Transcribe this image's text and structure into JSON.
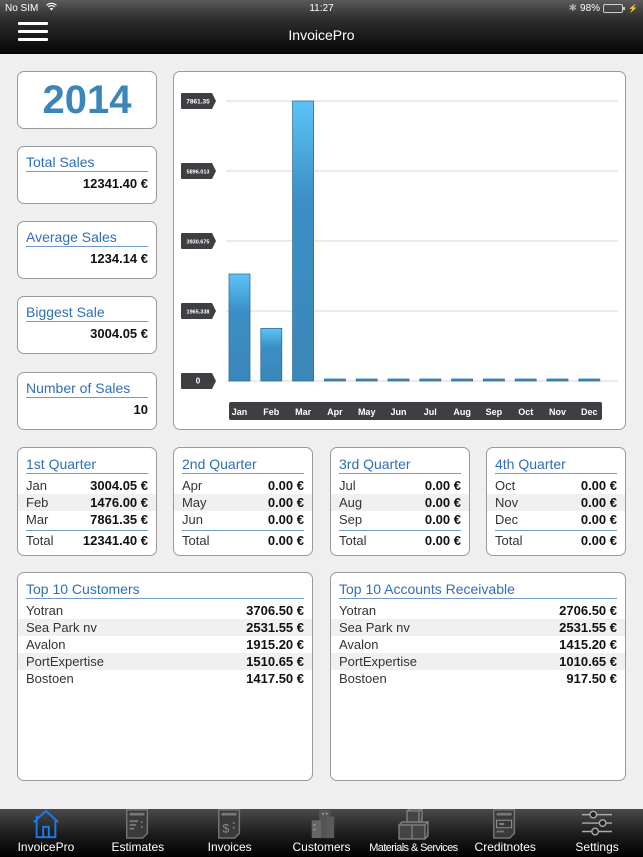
{
  "status_bar": {
    "carrier": "No SIM",
    "time": "11:27",
    "battery": "98%",
    "battery_level": 0.98
  },
  "header": {
    "title": "InvoicePro",
    "menu_icon": "hamburger-menu-icon"
  },
  "year": "2014",
  "stats": [
    {
      "label": "Total Sales",
      "value": "12341.40 €"
    },
    {
      "label": "Average Sales",
      "value": "1234.14 €"
    },
    {
      "label": "Biggest Sale",
      "value": "3004.05 €"
    },
    {
      "label": "Number of Sales",
      "value": "10"
    }
  ],
  "chart_data": {
    "type": "bar",
    "title": "",
    "xlabel": "",
    "ylabel": "",
    "categories": [
      "Jan",
      "Feb",
      "Mar",
      "Apr",
      "May",
      "Jun",
      "Jul",
      "Aug",
      "Sep",
      "Oct",
      "Nov",
      "Dec"
    ],
    "values": [
      3004.05,
      1476.0,
      7861.35,
      0,
      0,
      0,
      0,
      0,
      0,
      0,
      0,
      0
    ],
    "y_ticks": [
      "0",
      "1965.338",
      "3930.675",
      "5896.013",
      "7861.35"
    ],
    "ylim": [
      0,
      7861.35
    ],
    "grid": true,
    "bar_color": "#3b8fc6"
  },
  "quarters": [
    {
      "title": "1st Quarter",
      "rows": [
        {
          "label": "Jan",
          "value": "3004.05 €"
        },
        {
          "label": "Feb",
          "value": "1476.00 €"
        },
        {
          "label": "Mar",
          "value": "7861.35 €"
        }
      ],
      "total_label": "Total",
      "total": "12341.40 €"
    },
    {
      "title": "2nd Quarter",
      "rows": [
        {
          "label": "Apr",
          "value": "0.00 €"
        },
        {
          "label": "May",
          "value": "0.00 €"
        },
        {
          "label": "Jun",
          "value": "0.00 €"
        }
      ],
      "total_label": "Total",
      "total": "0.00 €"
    },
    {
      "title": "3rd Quarter",
      "rows": [
        {
          "label": "Jul",
          "value": "0.00 €"
        },
        {
          "label": "Aug",
          "value": "0.00 €"
        },
        {
          "label": "Sep",
          "value": "0.00 €"
        }
      ],
      "total_label": "Total",
      "total": "0.00 €"
    },
    {
      "title": "4th Quarter",
      "rows": [
        {
          "label": "Oct",
          "value": "0.00 €"
        },
        {
          "label": "Nov",
          "value": "0.00 €"
        },
        {
          "label": "Dec",
          "value": "0.00 €"
        }
      ],
      "total_label": "Total",
      "total": "0.00 €"
    }
  ],
  "top_customers": {
    "title": "Top 10 Customers",
    "rows": [
      {
        "label": "Yotran",
        "value": "3706.50 €"
      },
      {
        "label": "Sea Park nv",
        "value": "2531.55 €"
      },
      {
        "label": "Avalon",
        "value": "1915.20 €"
      },
      {
        "label": "PortExpertise",
        "value": "1510.65 €"
      },
      {
        "label": "Bostoen",
        "value": "1417.50 €"
      }
    ]
  },
  "top_receivables": {
    "title": "Top 10 Accounts Receivable",
    "rows": [
      {
        "label": "Yotran",
        "value": "2706.50 €"
      },
      {
        "label": "Sea Park nv",
        "value": "2531.55 €"
      },
      {
        "label": "Avalon",
        "value": "1415.20 €"
      },
      {
        "label": "PortExpertise",
        "value": "1010.65 €"
      },
      {
        "label": "Bostoen",
        "value": "917.50 €"
      }
    ]
  },
  "tabs": [
    {
      "label": "InvoicePro",
      "icon": "home-icon",
      "active": true
    },
    {
      "label": "Estimates",
      "icon": "estimate-document-icon"
    },
    {
      "label": "Invoices",
      "icon": "invoice-dollar-icon"
    },
    {
      "label": "Customers",
      "icon": "buildings-icon"
    },
    {
      "label": "Materials & Services",
      "icon": "boxes-icon"
    },
    {
      "label": "Creditnotes",
      "icon": "creditnote-document-icon"
    },
    {
      "label": "Settings",
      "icon": "sliders-icon"
    }
  ],
  "colors": {
    "accent": "#2e6fb7",
    "year": "#3a86b8",
    "active_tab": "#1a7cf0"
  }
}
